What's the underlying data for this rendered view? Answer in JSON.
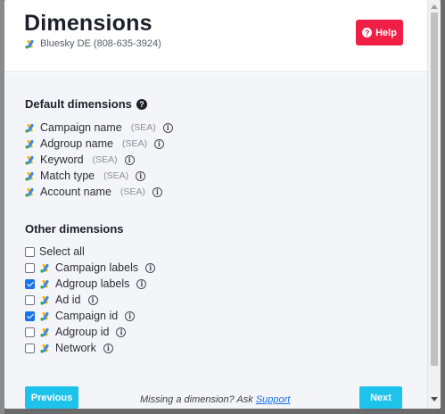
{
  "header": {
    "title": "Dimensions",
    "account": "Bluesky DE (808-635-3924)",
    "help_label": "Help"
  },
  "default_dimensions": {
    "heading": "Default dimensions",
    "items": [
      {
        "label": "Campaign name",
        "tag": "(SEA)"
      },
      {
        "label": "Adgroup name",
        "tag": "(SEA)"
      },
      {
        "label": "Keyword",
        "tag": "(SEA)"
      },
      {
        "label": "Match type",
        "tag": "(SEA)"
      },
      {
        "label": "Account name",
        "tag": "(SEA)"
      }
    ]
  },
  "other_dimensions": {
    "heading": "Other dimensions",
    "select_all_label": "Select all",
    "items": [
      {
        "label": "Campaign labels",
        "checked": false
      },
      {
        "label": "Adgroup labels",
        "checked": true
      },
      {
        "label": "Ad id",
        "checked": false
      },
      {
        "label": "Campaign id",
        "checked": true
      },
      {
        "label": "Adgroup id",
        "checked": false
      },
      {
        "label": "Network",
        "checked": false
      }
    ]
  },
  "footer": {
    "previous_label": "Previous",
    "missing_text": "Missing a dimension? Ask ",
    "support_link": "Support",
    "next_label": "Next"
  },
  "icons": {
    "ads_logo": "google-ads-icon",
    "info": "info-icon",
    "help": "question-circle-icon"
  },
  "colors": {
    "help_button": "#ef1f45",
    "nav_button": "#1ec3ec",
    "checkbox_checked": "#1a73e8",
    "link": "#1a73e8"
  }
}
